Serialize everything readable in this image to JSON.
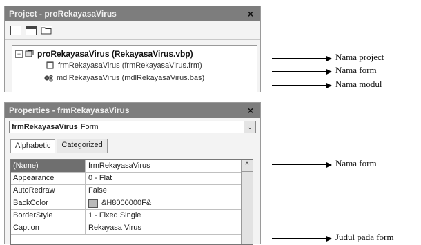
{
  "project_panel": {
    "title": "Project - proRekayasaVirus",
    "close": "×",
    "toolbar": [
      "view-code-icon",
      "view-object-icon",
      "toggle-folders-icon"
    ],
    "tree": {
      "root_expander": "−",
      "root": "proRekayasaVirus (RekayasaVirus.vbp)",
      "items": [
        "frmRekayasaVirus (frmRekayasaVirus.frm)",
        "mdlRekayasaVirus (mdlRekayasaVirus.bas)"
      ]
    }
  },
  "properties_panel": {
    "title": "Properties - frmRekayasaVirus",
    "close": "×",
    "object_name": "frmRekayasaVirus",
    "object_type": "Form",
    "dropdown": "⌄",
    "tabs": [
      "Alphabetic",
      "Categorized"
    ],
    "rows": [
      {
        "name": "(Name)",
        "value": "frmRekayasaVirus"
      },
      {
        "name": "Appearance",
        "value": "0 - Flat"
      },
      {
        "name": "AutoRedraw",
        "value": "False"
      },
      {
        "name": "BackColor",
        "value": "&H8000000F&"
      },
      {
        "name": "BorderStyle",
        "value": "1 - Fixed Single"
      },
      {
        "name": "Caption",
        "value": "Rekayasa Virus"
      }
    ],
    "scroll_up": "^"
  },
  "annotations": [
    "Nama project",
    "Nama form",
    "Nama modul",
    "Nama form",
    "Judul pada form"
  ]
}
